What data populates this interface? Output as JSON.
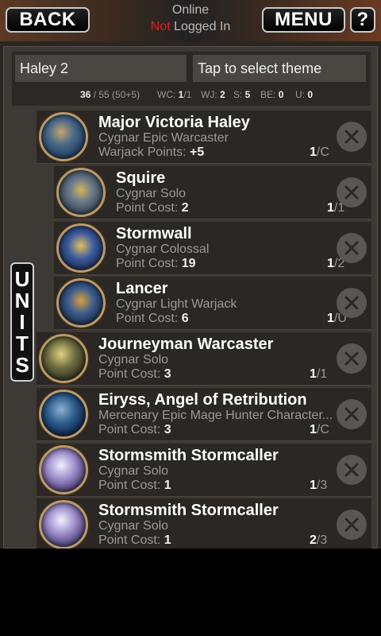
{
  "topbar": {
    "back_label": "BACK",
    "menu_label": "MENU",
    "help_label": "?",
    "status_line1": "Online",
    "status_not": "Not",
    "status_rest": " Logged In"
  },
  "list": {
    "name": "Haley 2",
    "theme_placeholder": "Tap to select theme",
    "stats": {
      "points": "36",
      "points_rest": " / 55 (50+5)",
      "wc_label": "WC: ",
      "wc_value": "1",
      "wc_rest": "/1",
      "wj_label": "WJ: ",
      "wj_value": "2",
      "s_label": "S: ",
      "s_value": "5",
      "be_label": "BE: ",
      "be_value": "0",
      "u_label": "U: ",
      "u_value": "0"
    }
  },
  "units_tab_letters": [
    "U",
    "N",
    "I",
    "T",
    "S"
  ],
  "colors": {
    "accent_red": "#d22222",
    "portrait_rim": "#b89a6a"
  },
  "units": [
    {
      "name": "Major Victoria Haley",
      "type": "Cygnar Epic Warcaster",
      "cost_label": "Warjack Points: ",
      "cost": "+5",
      "count": "1",
      "count_rest": "/C"
    },
    {
      "name": "Squire",
      "type": "Cygnar Solo",
      "cost_label": "Point Cost: ",
      "cost": "2",
      "count": "1",
      "count_rest": "/1"
    },
    {
      "name": "Stormwall",
      "type": "Cygnar Colossal",
      "cost_label": "Point Cost: ",
      "cost": "19",
      "count": "1",
      "count_rest": "/2"
    },
    {
      "name": "Lancer",
      "type": "Cygnar Light Warjack",
      "cost_label": "Point Cost: ",
      "cost": "6",
      "count": "1",
      "count_rest": "/U"
    },
    {
      "name": "Journeyman Warcaster",
      "type": "Cygnar Solo",
      "cost_label": "Point Cost: ",
      "cost": "3",
      "count": "1",
      "count_rest": "/1"
    },
    {
      "name": "Eiryss, Angel of Retribution",
      "type": "Mercenary Epic Mage Hunter Character...",
      "cost_label": "Point Cost: ",
      "cost": "3",
      "count": "1",
      "count_rest": "/C"
    },
    {
      "name": "Stormsmith Stormcaller",
      "type": "Cygnar Solo",
      "cost_label": "Point Cost: ",
      "cost": "1",
      "count": "1",
      "count_rest": "/3"
    },
    {
      "name": "Stormsmith Stormcaller",
      "type": "Cygnar Solo",
      "cost_label": "Point Cost: ",
      "cost": "1",
      "count": "2",
      "count_rest": "/3"
    }
  ]
}
